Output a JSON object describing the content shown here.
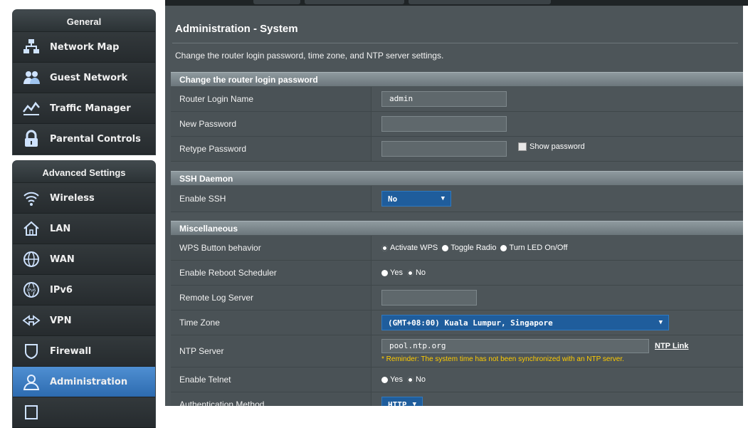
{
  "sidebar": {
    "general": {
      "title": "General",
      "items": [
        {
          "label": "Network Map",
          "icon": "network-map-icon"
        },
        {
          "label": "Guest Network",
          "icon": "guest-network-icon"
        },
        {
          "label": "Traffic Manager",
          "icon": "traffic-manager-icon"
        },
        {
          "label": "Parental Controls",
          "icon": "parental-controls-icon"
        }
      ]
    },
    "advanced": {
      "title": "Advanced Settings",
      "items": [
        {
          "label": "Wireless",
          "icon": "wireless-icon"
        },
        {
          "label": "LAN",
          "icon": "lan-icon"
        },
        {
          "label": "WAN",
          "icon": "wan-icon"
        },
        {
          "label": "IPv6",
          "icon": "ipv6-icon"
        },
        {
          "label": "VPN",
          "icon": "vpn-icon"
        },
        {
          "label": "Firewall",
          "icon": "firewall-icon"
        },
        {
          "label": "Administration",
          "icon": "administration-icon",
          "active": true
        }
      ]
    }
  },
  "page": {
    "title": "Administration - System",
    "description": "Change the router login password, time zone, and NTP server settings."
  },
  "sections": {
    "login": {
      "title": "Change the router login password",
      "router_login_name_label": "Router Login Name",
      "router_login_name_value": "admin",
      "new_password_label": "New Password",
      "new_password_value": "",
      "retype_password_label": "Retype Password",
      "retype_password_value": "",
      "show_password_label": "Show password"
    },
    "ssh": {
      "title": "SSH Daemon",
      "enable_ssh_label": "Enable SSH",
      "enable_ssh_value": "No"
    },
    "misc": {
      "title": "Miscellaneous",
      "wps_label": "WPS Button behavior",
      "wps_options": [
        "Activate WPS",
        "Toggle Radio",
        "Turn LED On/Off"
      ],
      "wps_selected": "Activate WPS",
      "reboot_label": "Enable Reboot Scheduler",
      "reboot_yes": "Yes",
      "reboot_no": "No",
      "reboot_selected": "No",
      "remote_log_label": "Remote Log Server",
      "remote_log_value": "",
      "timezone_label": "Time Zone",
      "timezone_value": "(GMT+08:00) Kuala Lumpur, Singapore",
      "ntp_label": "NTP Server",
      "ntp_value": "pool.ntp.org",
      "ntp_link": "NTP Link",
      "ntp_reminder": "* Reminder: The system time has not been synchronized with an NTP server.",
      "telnet_label": "Enable Telnet",
      "telnet_yes": "Yes",
      "telnet_no": "No",
      "telnet_selected": "No",
      "auth_label": "Authentication Method",
      "auth_value": "HTTP"
    }
  },
  "colors": {
    "accent": "#2d6bb0",
    "panel": "#4d5559",
    "section_header": "#7b868b",
    "reminder": "#ffcc00"
  }
}
